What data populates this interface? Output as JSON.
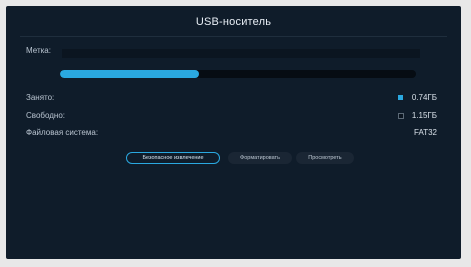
{
  "dialog": {
    "title": "USB-носитель"
  },
  "fields": {
    "label_caption": "Метка:",
    "used_caption": "Занято:",
    "free_caption": "Свободно:",
    "fs_caption": "Файловая система:",
    "used_value": "0.74ГБ",
    "free_value": "1.15ГБ",
    "fs_value": "FAT32"
  },
  "usage": {
    "used_fraction": 0.39
  },
  "buttons": {
    "eject_label": "Безопасное извлечение",
    "format_label": "Форматировать",
    "browse_label": "Просмотреть"
  },
  "colors": {
    "accent": "#2aa8e0",
    "background": "#0f1c2a"
  }
}
